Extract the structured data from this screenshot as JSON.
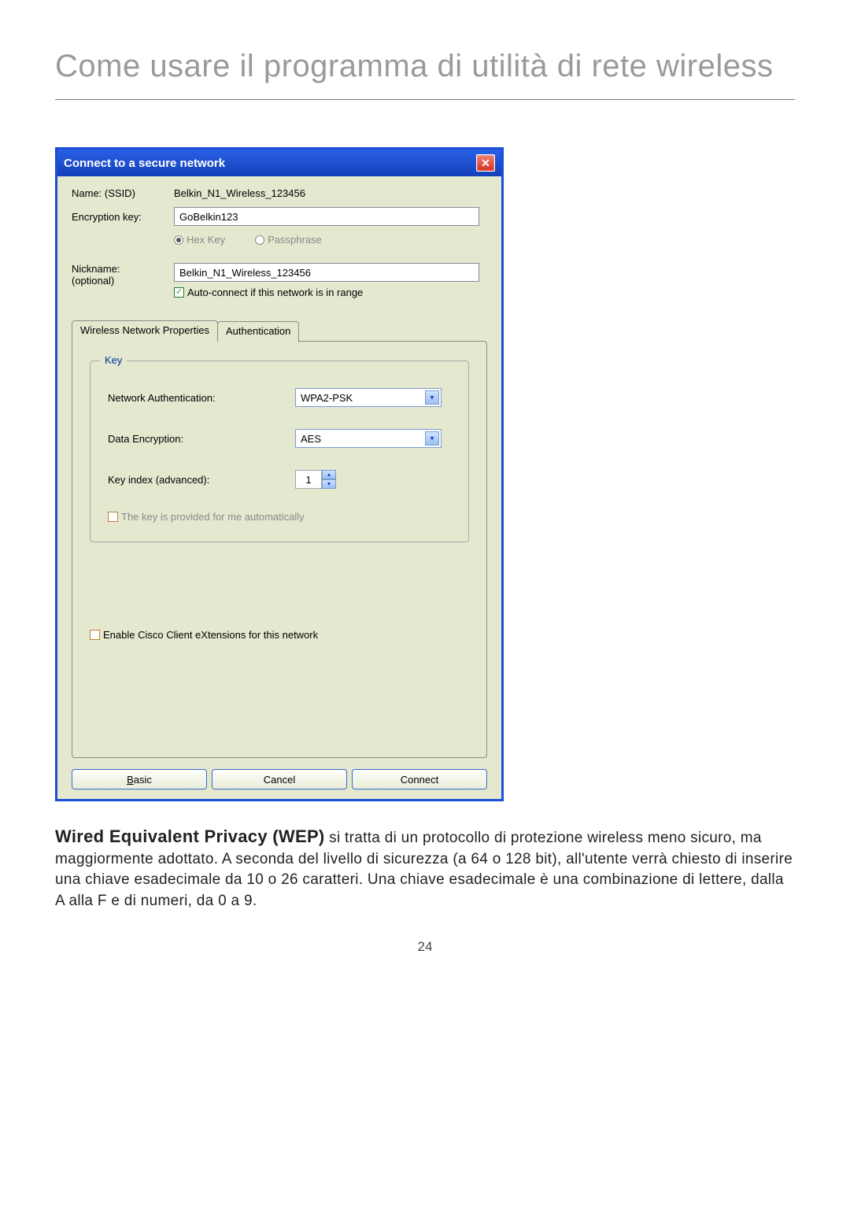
{
  "page": {
    "title": "Come usare il programma di utilità di rete wireless",
    "number": "24"
  },
  "dialog": {
    "title": "Connect to a secure network",
    "name_label": "Name:  (SSID)",
    "name_value": "Belkin_N1_Wireless_123456",
    "encryption_label": "Encryption key:",
    "encryption_value": "GoBelkin123",
    "radio_hex": "Hex Key",
    "radio_pass": "Passphrase",
    "nickname_label": "Nickname:",
    "nickname_optional": "(optional)",
    "nickname_value": "Belkin_N1_Wireless_123456",
    "autoconnect": "Auto-connect if this network is in range",
    "tabs": {
      "properties": "Wireless Network Properties",
      "auth": "Authentication"
    },
    "key_legend": "Key",
    "net_auth_label": "Network Authentication:",
    "net_auth_value": "WPA2-PSK",
    "data_enc_label": "Data Encryption:",
    "data_enc_value": "AES",
    "key_index_label": "Key index (advanced):",
    "key_index_value": "1",
    "auto_key": "The key is provided for me automatically",
    "cisco": "Enable Cisco Client eXtensions for this network",
    "buttons": {
      "basic_u": "B",
      "basic_rest": "asic",
      "cancel": "Cancel",
      "connect": "Connect"
    }
  },
  "paragraph": {
    "bold": "Wired Equivalent Privacy (WEP)",
    "rest": " si tratta di un protocollo di protezione wireless meno sicuro, ma maggiormente adottato. A seconda del livello di sicurezza (a 64 o 128 bit), all'utente verrà chiesto di inserire una chiave esadecimale da 10 o 26 caratteri. Una chiave esadecimale è una combinazione di lettere, dalla A alla F e di numeri, da 0 a 9."
  }
}
